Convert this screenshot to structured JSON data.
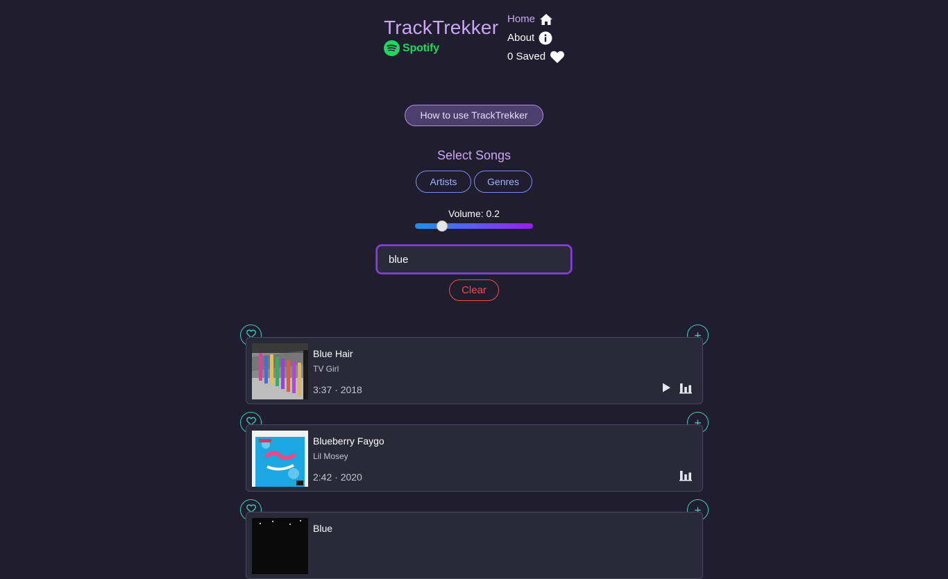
{
  "brand": {
    "title": "TrackTrekker",
    "spotify_label": "Spotify"
  },
  "nav": {
    "home": "Home",
    "about": "About",
    "saved": "0 Saved"
  },
  "howto_label": "How to use TrackTrekker",
  "select_title": "Select Songs",
  "chips": {
    "artists": "Artists",
    "genres": "Genres"
  },
  "volume": {
    "label": "Volume: 0.2",
    "value": 0.2
  },
  "search": {
    "value": "blue"
  },
  "clear_label": "Clear",
  "tracks": [
    {
      "title": "Blue Hair",
      "artist": "TV Girl",
      "meta": "3:37 · 2018",
      "has_play": true
    },
    {
      "title": "Blueberry Faygo",
      "artist": "Lil Mosey",
      "meta": "2:42 · 2020",
      "has_play": false
    },
    {
      "title": "Blue",
      "artist": "",
      "meta": "",
      "has_play": false
    }
  ],
  "colors": {
    "background": "#1f1d2e",
    "accent_purple": "#c9a7f2",
    "accent_teal": "#3fd0b5",
    "spotify_green": "#1ed760",
    "clear_red": "#ef4d4d"
  }
}
